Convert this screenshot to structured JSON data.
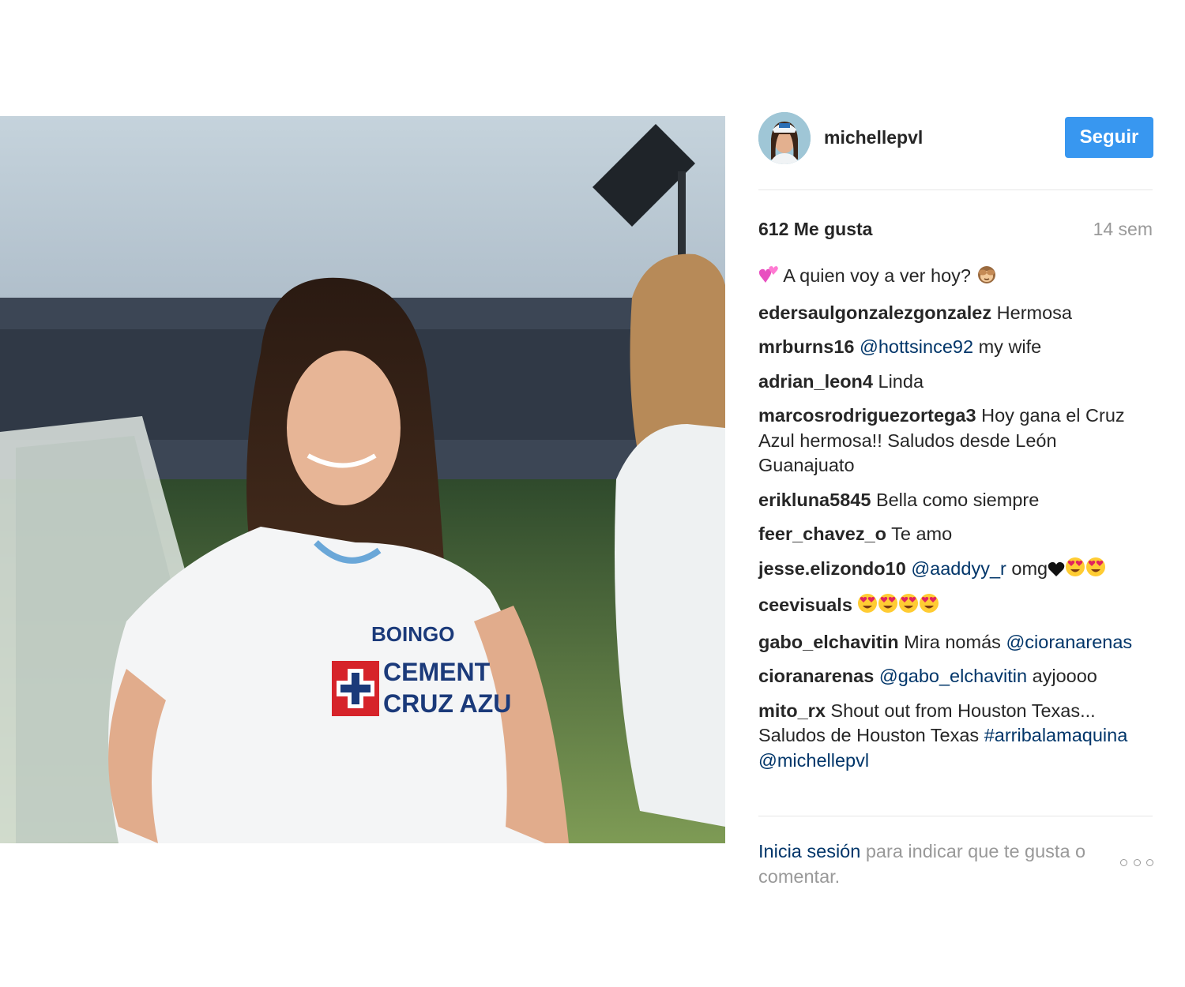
{
  "post": {
    "username": "michellepvl",
    "follow_label": "Seguir",
    "likes": "612 Me gusta",
    "age": "14 sem",
    "photo_logo_sponsor": "BOINGO",
    "photo_logo_line1": "CEMENT",
    "photo_logo_line2": "CRUZ AZU"
  },
  "caption": {
    "leading_emoji": "two-hearts-icon",
    "text": "A quien voy a ver hoy?",
    "trailing_emoji": "see-no-evil-monkey-icon"
  },
  "comments": [
    {
      "user": "edersaulgonzalezgonzalez",
      "text": "Hermosa"
    },
    {
      "user": "mrburns16",
      "mention": "@hottsince92",
      "text": "my wife"
    },
    {
      "user": "adrian_leon4",
      "text": "Linda"
    },
    {
      "user": "marcosrodriguezortega3",
      "text": "Hoy gana el Cruz Azul hermosa!! Saludos desde León Guanajuato"
    },
    {
      "user": "erikluna5845",
      "text": "Bella como siempre"
    },
    {
      "user": "feer_chavez_o",
      "text": "Te amo"
    },
    {
      "user": "jesse.elizondo10",
      "mention": "@aaddyy_r",
      "text": "omg"
    },
    {
      "user": "ceevisuals"
    },
    {
      "user": "gabo_elchavitin",
      "text": "Mira nomás",
      "mention": "@cioranarenas"
    },
    {
      "user": "cioranarenas",
      "mention": "@gabo_elchavitin",
      "text": "ayjoooo"
    },
    {
      "user": "mito_rx",
      "text": "Shout out from Houston Texas... Saludos de Houston Texas",
      "hashtag": "#arribalamaquina",
      "mention": "@michellepvl"
    }
  ],
  "footer": {
    "login_link": "Inicia sesión",
    "login_text": "para indicar que te gusta o comentar."
  },
  "colors": {
    "follow_button": "#3897f0",
    "mention": "#003569",
    "muted": "#999999",
    "text": "#262626"
  }
}
